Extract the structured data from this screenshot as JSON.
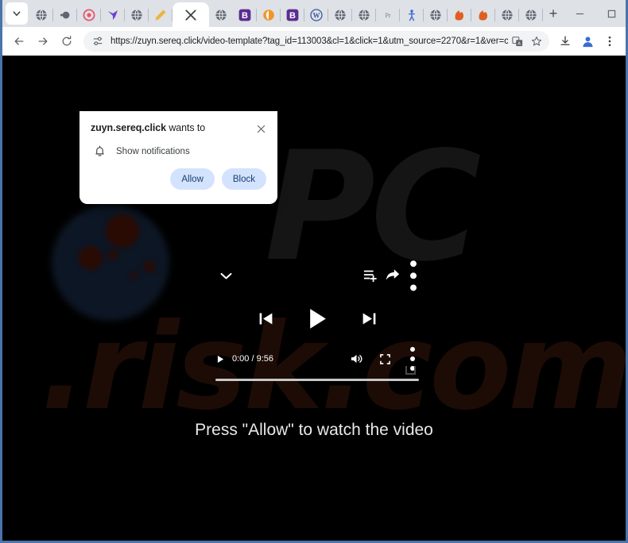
{
  "window": {
    "controls": {
      "minimize": "minimize-icon",
      "maximize": "maximize-icon",
      "close": "close-icon"
    }
  },
  "tabstrip": {
    "tab_search_icon": "chevron-down-icon",
    "new_tab_label": "+",
    "tabs": [
      {
        "favicon": "globe-cursor-icon",
        "color": "#5f6672",
        "type": "globe"
      },
      {
        "favicon": "globe-small-icon",
        "color": "#5f6672",
        "type": "globe-small"
      },
      {
        "favicon": "target-icon",
        "color": "#e8546b",
        "type": "target"
      },
      {
        "favicon": "bird-icon",
        "color": "#6b3fd4",
        "type": "bird"
      },
      {
        "favicon": "globe-icon",
        "color": "#5f6672",
        "type": "globe"
      },
      {
        "favicon": "pencil-icon",
        "color": "#e9b63a",
        "type": "pencil"
      },
      {
        "favicon": "close-icon",
        "color": "#3c4043",
        "type": "active",
        "active": true
      },
      {
        "favicon": "globe-icon",
        "color": "#5f6672",
        "type": "globe"
      },
      {
        "favicon": "b-letter-icon",
        "color": "#5b2d91",
        "type": "letter",
        "letter": "B"
      },
      {
        "favicon": "orange-drop-icon",
        "color": "#f0962a",
        "type": "drop"
      },
      {
        "favicon": "b-letter-icon",
        "color": "#5b2d91",
        "type": "letter",
        "letter": "B"
      },
      {
        "favicon": "wordpress-icon",
        "color": "#3858a0",
        "type": "wordpress"
      },
      {
        "favicon": "globe-icon",
        "color": "#5f6672",
        "type": "globe"
      },
      {
        "favicon": "globe-icon",
        "color": "#5f6672",
        "type": "globe"
      },
      {
        "favicon": "pr-text-icon",
        "color": "#7a7f87",
        "type": "text",
        "letter": "Pr"
      },
      {
        "favicon": "person-icon",
        "color": "#3a6bd4",
        "type": "person"
      },
      {
        "favicon": "globe-icon",
        "color": "#5f6672",
        "type": "globe"
      },
      {
        "favicon": "dragon-icon",
        "color": "#e05e22",
        "type": "dragon"
      },
      {
        "favicon": "dragon-icon",
        "color": "#e05e22",
        "type": "dragon"
      },
      {
        "favicon": "globe-icon",
        "color": "#5f6672",
        "type": "globe"
      },
      {
        "favicon": "globe-icon",
        "color": "#5f6672",
        "type": "globe"
      }
    ]
  },
  "toolbar": {
    "back_icon": "back-arrow-icon",
    "forward_icon": "forward-arrow-icon",
    "reload_icon": "reload-icon",
    "site_settings_icon": "tune-sliders-icon",
    "url": "https://zuyn.sereq.click/video-template?tag_id=113003&cl=1&click=1&utm_source=2270&r=1&ver=c",
    "translate_icon": "translate-icon",
    "bookmark_icon": "star-icon",
    "download_icon": "download-icon",
    "profile_icon": "avatar-icon",
    "menu_icon": "kebab-menu-icon"
  },
  "notification": {
    "origin": "zuyn.sereq.click",
    "title_suffix": " wants to",
    "permission": "Show notifications",
    "bell_icon": "bell-icon",
    "close_icon": "close-icon",
    "allow_label": "Allow",
    "block_label": "Block",
    "button_bg": "#d3e3fd",
    "button_text_color": "#1a3d73"
  },
  "page": {
    "background_color": "#000000",
    "headline": "Press \"Allow\" to watch the video",
    "watermark_primary": "PC",
    "watermark_secondary": ".risk.com",
    "player": {
      "collapse_icon": "chevron-down-icon",
      "queue_icon": "add-to-queue-icon",
      "share_icon": "share-arrow-icon",
      "menu_icon": "kebab-menu-icon",
      "prev_icon": "skip-previous-icon",
      "play_icon": "play-icon",
      "next_icon": "skip-next-icon",
      "small_play_icon": "play-icon",
      "time_display": "0:00 / 9:56",
      "current_time": "0:00",
      "duration": "9:56",
      "volume_icon": "volume-icon",
      "fullscreen_icon": "fullscreen-icon",
      "overflow_icon": "kebab-menu-icon",
      "progress_percent": 0
    }
  }
}
